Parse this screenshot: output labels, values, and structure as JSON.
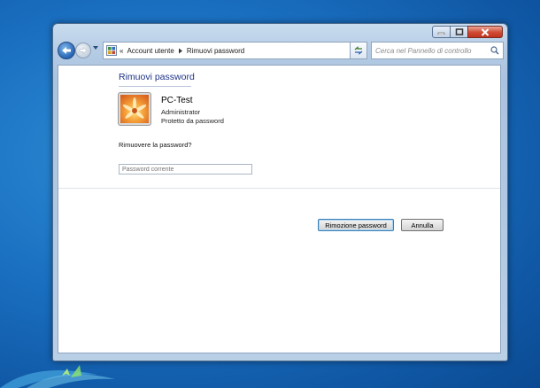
{
  "breadcrumb": {
    "root_chevron": "«",
    "items": [
      "Account utente",
      "Rimuovi password"
    ]
  },
  "search": {
    "placeholder": "Cerca nel Pannello di controllo"
  },
  "page": {
    "title": "Rimuovi password",
    "user": {
      "name": "PC-Test",
      "role": "Administrator",
      "status": "Protetto da password"
    },
    "question": "Rimuovere la password?",
    "password_placeholder": "Password corrente",
    "buttons": {
      "remove": "Rimozione password",
      "cancel": "Annulla"
    }
  },
  "colors": {
    "title_blue": "#1e3287",
    "desktop_blue": "#1a6fc0",
    "close_red": "#c0331f"
  },
  "icons": {
    "back": "back-arrow-icon",
    "forward": "forward-arrow-icon",
    "control_panel": "control-panel-icon",
    "refresh": "refresh-icon",
    "search": "search-icon",
    "user_picture": "flower-user-picture"
  }
}
